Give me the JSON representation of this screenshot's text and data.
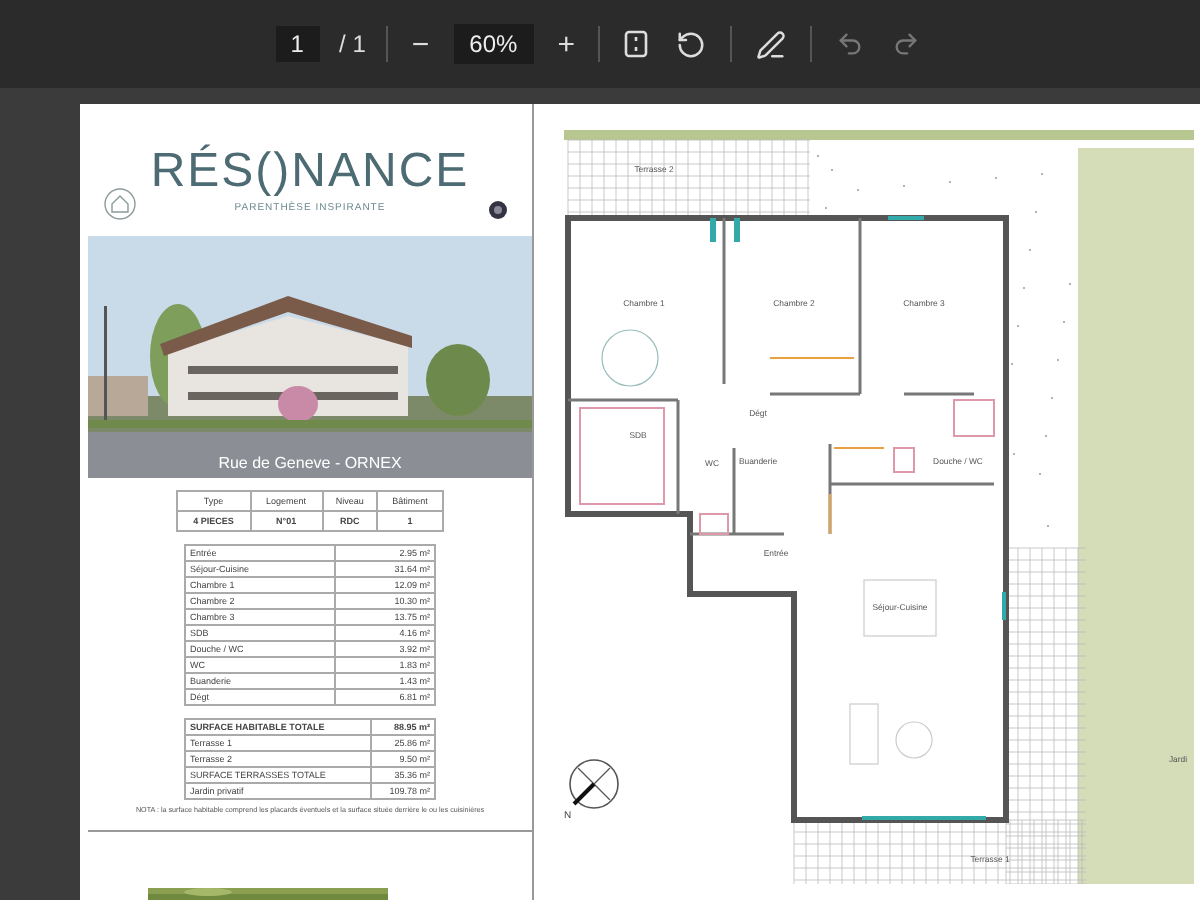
{
  "toolbar": {
    "page_input": "1",
    "page_total": "/ 1",
    "zoom_out": "−",
    "zoom": "60%",
    "zoom_in": "+",
    "undo_disabled": true,
    "redo_disabled": true
  },
  "sheet": {
    "brand": "RÉS()NANCE",
    "tagline": "PARENTHÈSE INSPIRANTE",
    "photo_caption": "Rue de Geneve - ORNEX",
    "info_columns": [
      "Type",
      "Logement",
      "Niveau",
      "Bâtiment"
    ],
    "info_values": [
      "4 PIECES",
      "N°01",
      "RDC",
      "1"
    ],
    "rooms": [
      {
        "name": "Entrée",
        "area": "2.95 m²"
      },
      {
        "name": "Séjour-Cuisine",
        "area": "31.64 m²"
      },
      {
        "name": "Chambre 1",
        "area": "12.09 m²"
      },
      {
        "name": "Chambre 2",
        "area": "10.30 m²"
      },
      {
        "name": "Chambre 3",
        "area": "13.75 m²"
      },
      {
        "name": "SDB",
        "area": "4.16 m²"
      },
      {
        "name": "Douche / WC",
        "area": "3.92 m²"
      },
      {
        "name": "WC",
        "area": "1.83 m²"
      },
      {
        "name": "Buanderie",
        "area": "1.43 m²"
      },
      {
        "name": "Dégt",
        "area": "6.81 m²"
      }
    ],
    "totals": [
      {
        "name": "SURFACE HABITABLE TOTALE",
        "area": "88.95 m²",
        "bold": true
      },
      {
        "name": "Terrasse 1",
        "area": "25.86 m²",
        "bold": false
      },
      {
        "name": "Terrasse 2",
        "area": "9.50 m²",
        "bold": false
      },
      {
        "name": "SURFACE TERRASSES TOTALE",
        "area": "35.36 m²",
        "bold": false
      },
      {
        "name": "Jardin privatif",
        "area": "109.78 m²",
        "bold": false
      }
    ],
    "note": "NOTA : la surface habitable comprend les placards éventuels et la surface située derrière le ou les cuisinières"
  },
  "plan": {
    "labels": [
      "Terrasse 2",
      "Chambre 1",
      "Chambre 2",
      "Chambre 3",
      "SDB",
      "Dégt",
      "WC",
      "Buanderie",
      "Douche / WC",
      "Entrée",
      "Séjour-Cuisine",
      "Terrasse 1",
      "Jardi"
    ],
    "compass": "N"
  }
}
